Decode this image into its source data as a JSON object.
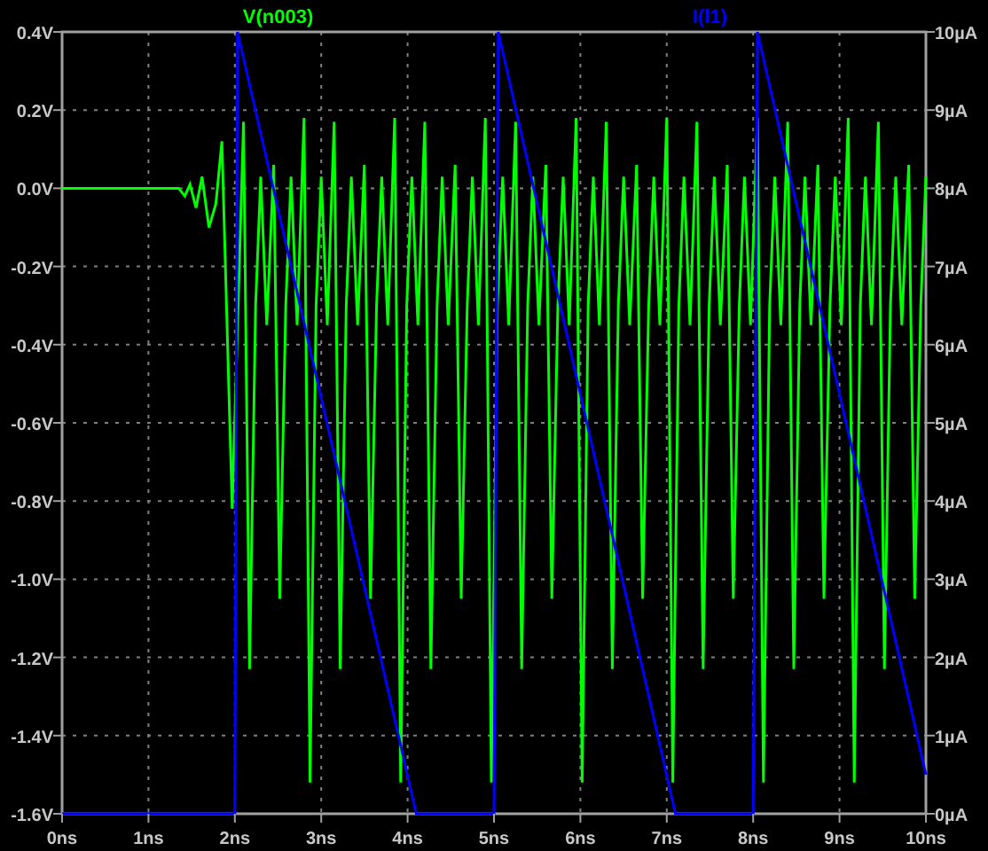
{
  "plot": {
    "chart_data": {
      "type": "line",
      "grid": true,
      "xlim": [
        0,
        10
      ],
      "ylim": [
        -1.6,
        0.4
      ],
      "y2lim": [
        0,
        10
      ],
      "xticks": [
        {
          "value": 0,
          "label": "0ns"
        },
        {
          "value": 1,
          "label": "1ns"
        },
        {
          "value": 2,
          "label": "2ns"
        },
        {
          "value": 3,
          "label": "3ns"
        },
        {
          "value": 4,
          "label": "4ns"
        },
        {
          "value": 5,
          "label": "5ns"
        },
        {
          "value": 6,
          "label": "6ns"
        },
        {
          "value": 7,
          "label": "7ns"
        },
        {
          "value": 8,
          "label": "8ns"
        },
        {
          "value": 9,
          "label": "9ns"
        },
        {
          "value": 10,
          "label": "10ns"
        }
      ],
      "yticks": [
        {
          "value": 0.4,
          "label": "0.4V"
        },
        {
          "value": 0.2,
          "label": "0.2V"
        },
        {
          "value": 0,
          "label": "0.0V"
        },
        {
          "value": -0.2,
          "label": "-0.2V"
        },
        {
          "value": -0.4,
          "label": "-0.4V"
        },
        {
          "value": -0.6,
          "label": "-0.6V"
        },
        {
          "value": -0.8,
          "label": "-0.8V"
        },
        {
          "value": -1.0,
          "label": "-1.0V"
        },
        {
          "value": -1.2,
          "label": "-1.2V"
        },
        {
          "value": -1.4,
          "label": "-1.4V"
        },
        {
          "value": -1.6,
          "label": "-1.6V"
        }
      ],
      "y2ticks": [
        {
          "value": 10,
          "label": "10µA"
        },
        {
          "value": 9,
          "label": "9µA"
        },
        {
          "value": 8,
          "label": "8µA"
        },
        {
          "value": 7,
          "label": "7µA"
        },
        {
          "value": 6,
          "label": "6µA"
        },
        {
          "value": 5,
          "label": "5µA"
        },
        {
          "value": 4,
          "label": "4µA"
        },
        {
          "value": 3,
          "label": "3µA"
        },
        {
          "value": 2,
          "label": "2µA"
        },
        {
          "value": 1,
          "label": "1µA"
        },
        {
          "value": 0,
          "label": "0µA"
        }
      ],
      "series": [
        {
          "name": "V(n003)",
          "color": "#00ff00",
          "axis": "y",
          "x": [
            0,
            1.35,
            1.42,
            1.48,
            1.55,
            1.62,
            1.7,
            1.78,
            1.85,
            1.97,
            2.1,
            2.17,
            2.24,
            2.3,
            2.37,
            2.45,
            2.52,
            2.59,
            2.65,
            2.72,
            2.8,
            2.87,
            2.94,
            3.0,
            3.07,
            3.15,
            3.22,
            3.29,
            3.35,
            3.42,
            3.5,
            3.57,
            3.64,
            3.7,
            3.77,
            3.85,
            3.92,
            3.99,
            4.05,
            4.12,
            4.2,
            4.27,
            4.34,
            4.4,
            4.47,
            4.55,
            4.62,
            4.69,
            4.75,
            4.82,
            4.9,
            4.97,
            5.04,
            5.1,
            5.17,
            5.25,
            5.32,
            5.39,
            5.45,
            5.52,
            5.6,
            5.67,
            5.74,
            5.8,
            5.87,
            5.95,
            6.02,
            6.09,
            6.15,
            6.22,
            6.3,
            6.37,
            6.44,
            6.5,
            6.57,
            6.65,
            6.72,
            6.79,
            6.85,
            6.92,
            7.0,
            7.07,
            7.14,
            7.2,
            7.27,
            7.35,
            7.42,
            7.49,
            7.55,
            7.62,
            7.7,
            7.77,
            7.84,
            7.9,
            7.97,
            8.05,
            8.12,
            8.19,
            8.25,
            8.32,
            8.4,
            8.47,
            8.54,
            8.6,
            8.67,
            8.75,
            8.82,
            8.89,
            8.95,
            9.02,
            9.1,
            9.17,
            9.24,
            9.3,
            9.37,
            9.45,
            9.52,
            9.59,
            9.65,
            9.72,
            9.8,
            9.87,
            9.94,
            10.0
          ],
          "values": [
            0,
            0,
            -0.02,
            0.01,
            -0.05,
            0.03,
            -0.1,
            -0.04,
            0.12,
            -0.82,
            0.17,
            -1.23,
            -0.3,
            0.03,
            -0.35,
            0.06,
            -1.05,
            -0.3,
            0.03,
            -0.35,
            0.18,
            -1.52,
            -0.3,
            0.03,
            -0.35,
            0.17,
            -1.23,
            -0.3,
            0.03,
            -0.35,
            0.06,
            -1.05,
            -0.3,
            0.03,
            -0.35,
            0.18,
            -1.52,
            -0.3,
            0.03,
            -0.35,
            0.17,
            -1.23,
            -0.3,
            0.03,
            -0.35,
            0.06,
            -1.05,
            -0.3,
            0.03,
            -0.35,
            0.18,
            -1.52,
            -0.3,
            0.03,
            -0.35,
            0.17,
            -1.23,
            -0.3,
            0.03,
            -0.35,
            0.06,
            -1.05,
            -0.3,
            0.03,
            -0.35,
            0.18,
            -1.52,
            -0.3,
            0.03,
            -0.35,
            0.17,
            -1.23,
            -0.3,
            0.03,
            -0.35,
            0.06,
            -1.05,
            -0.3,
            0.03,
            -0.35,
            0.18,
            -1.52,
            -0.3,
            0.03,
            -0.35,
            0.17,
            -1.23,
            -0.3,
            0.03,
            -0.35,
            0.06,
            -1.05,
            -0.3,
            0.03,
            -0.35,
            0.18,
            -1.52,
            -0.3,
            0.03,
            -0.35,
            0.17,
            -1.23,
            -0.3,
            0.03,
            -0.35,
            0.06,
            -1.05,
            -0.3,
            0.03,
            -0.35,
            0.18,
            -1.52,
            -0.3,
            0.03,
            -0.35,
            0.17,
            -1.23,
            -0.3,
            0.03,
            -0.35,
            0.06,
            -1.05,
            -0.3,
            0.03
          ]
        },
        {
          "name": "I(l1)",
          "color": "#0000ff",
          "axis": "y2",
          "x": [
            0,
            2.0,
            2.03,
            4.1,
            5.0,
            5.05,
            7.1,
            8.0,
            8.05,
            10.0
          ],
          "values": [
            0,
            0,
            10,
            0,
            0,
            10,
            0,
            0,
            10,
            0.5
          ]
        }
      ]
    }
  }
}
